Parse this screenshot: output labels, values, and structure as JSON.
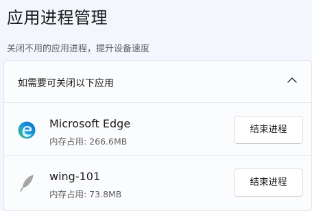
{
  "page": {
    "title": "应用进程管理",
    "subtitle": "关闭不用的应用进程，提升设备速度"
  },
  "panel": {
    "header_label": "如需要可关闭以下应用",
    "header_icon": "chevron-up-icon",
    "apps": [
      {
        "name": "Microsoft Edge",
        "memory": "内存占用: 266.6MB",
        "icon": "edge-browser-icon",
        "button_label": "结束进程"
      },
      {
        "name": "wing-101",
        "memory": "内存占用: 73.8MB",
        "icon": "feather-quill-icon",
        "button_label": "结束进程"
      }
    ]
  },
  "colors": {
    "background": "#f3f6fc",
    "panel": "#fbfcfe",
    "button": "#ffffff",
    "edge_blue": "#1b7ee0",
    "edge_green": "#3fbf5a"
  }
}
